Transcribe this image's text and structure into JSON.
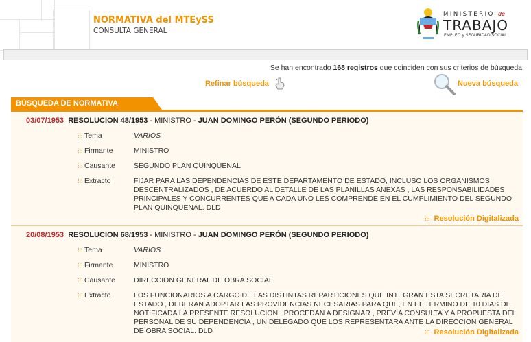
{
  "header": {
    "system_title": "NORMATIVA del MTEySS",
    "system_subtitle": "CONSULTA GENERAL",
    "logo": {
      "line1": "MINISTERIO",
      "line1_suffix": "de",
      "line2": "TRABAJO",
      "line3": "EMPLEO y SEGURIDAD SOCIAL"
    }
  },
  "results": {
    "prefix": "Se han encontrado",
    "count": "168 registros",
    "suffix": "que coinciden con sus criterios de búsqueda"
  },
  "actions": {
    "refine_label": "Refinar búsqueda",
    "new_search_label": "Nueva búsqueda"
  },
  "section": {
    "title": "BÚSQUEDA DE NORMATIVA"
  },
  "colors": {
    "accent": "#f39200",
    "date": "#c0272d",
    "separator": "#f6c987"
  },
  "records": [
    {
      "date": "03/07/1953",
      "number": "RESOLUCION 48/1953",
      "authority": "MINISTRO",
      "signer_head": "JUAN DOMINGO PERÓN (SEGUNDO PERIODO)",
      "fields": [
        {
          "label": "Tema",
          "value": "VARIOS"
        },
        {
          "label": "Firmante",
          "value": "MINISTRO"
        },
        {
          "label": "Causante",
          "value": "SEGUNDO PLAN QUINQUENAL"
        },
        {
          "label": "Extracto",
          "value": "FIJAR PARA LAS DEPENDENCIAS DE ESTE DEPARTAMENTO DE ESTADO, INCLUSO LOS ORGANISMOS DESCENTRALIZADOS , DE ACUERDO AL DETALLE DE LAS PLANILLAS ANEXAS , LAS RESPONSABILIDADES PRINCIPALES Y CONCURRENTES QUE A CADA UNO LES COMPRENDE EN EL CUMPLIMIENTO DEL SEGUNDO PLAN QUINQUENAL. DLD"
        }
      ],
      "digital_link": "Resolución Digitalizada"
    },
    {
      "date": "20/08/1953",
      "number": "RESOLUCION 68/1953",
      "authority": "MINISTRO",
      "signer_head": "JUAN DOMINGO PERÓN (SEGUNDO PERIODO)",
      "fields": [
        {
          "label": "Tema",
          "value": "VARIOS"
        },
        {
          "label": "Firmante",
          "value": "MINISTRO"
        },
        {
          "label": "Causante",
          "value": "DIRECCION GENERAL DE OBRA SOCIAL"
        },
        {
          "label": "Extracto",
          "value": "LOS FUNCIONARIOS A CARGO DE LAS DISTINTAS REPARTICIONES QUE INTEGRAN ESTA SECRETARIA DE ESTADO , DEBERAN ADOPTAR LAS PROVIDENCIAS NECESARIAS PARA QUE, EN EL TERMINO DE 10 DIAS DE NOTIFICADA LA PRESENTE RESOLUCION , PROCEDAN A DESIGNAR , PREVIA CONSULTA Y A PROPUESTA DEL PERSONAL DE SU DEPENDENCIA , UN DELEGADO QUE LOS REPRESENTARA ANTE LA DIRECCION GENERAL DE OBRA SOCIAL. DLD"
        }
      ],
      "digital_link": "Resolución Digitalizada"
    }
  ]
}
